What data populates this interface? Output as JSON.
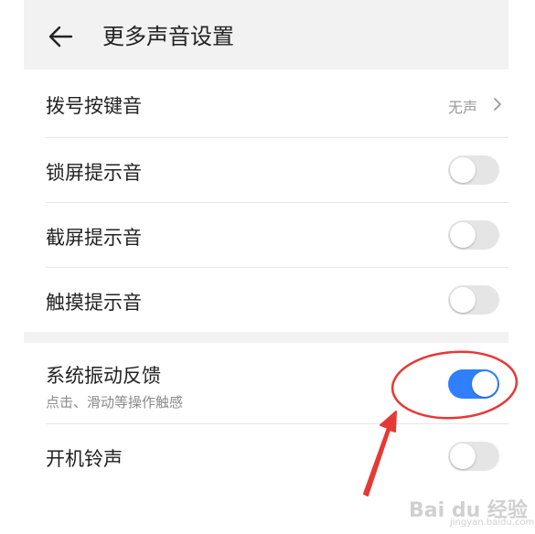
{
  "header": {
    "title": "更多声音设置",
    "back_icon": "arrow-left-icon"
  },
  "rows": [
    {
      "label": "拨号按键音",
      "value": "无声"
    },
    {
      "label": "锁屏提示音",
      "enabled": false
    },
    {
      "label": "截屏提示音",
      "enabled": false
    },
    {
      "label": "触摸提示音",
      "enabled": false
    },
    {
      "label": "系统振动反馈",
      "sub": "点击、滑动等操作触感",
      "enabled": true
    },
    {
      "label": "开机铃声",
      "enabled": false
    }
  ],
  "annotation": {
    "color": "#e53935",
    "shape": "ellipse-and-arrow"
  },
  "watermark": {
    "text": "Bai du 经验",
    "url_text": "jingyan.baidu.com"
  },
  "colors": {
    "accent": "#2f7fff",
    "background_gray": "#f2f2f2"
  }
}
